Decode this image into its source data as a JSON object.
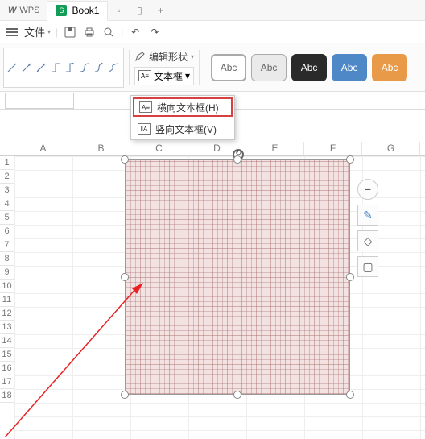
{
  "titlebar": {
    "app": "WPS",
    "book": "Book1",
    "plus": "+"
  },
  "menubar": {
    "file": "文件",
    "undo": "↶",
    "redo": "↷"
  },
  "ribbon": {
    "edit_shape": "编辑形状",
    "textbox": "文本框",
    "swatch_label": "Abc"
  },
  "dropdown": {
    "horizontal": "横向文本框(H)",
    "vertical": "竖向文本框(V)"
  },
  "columns": [
    "A",
    "B",
    "C",
    "D",
    "E",
    "F",
    "G"
  ],
  "rows": [
    "1",
    "2",
    "3",
    "4",
    "5",
    "6",
    "7",
    "8",
    "9",
    "10",
    "11",
    "12",
    "13",
    "14",
    "15",
    "16",
    "17",
    "18"
  ]
}
